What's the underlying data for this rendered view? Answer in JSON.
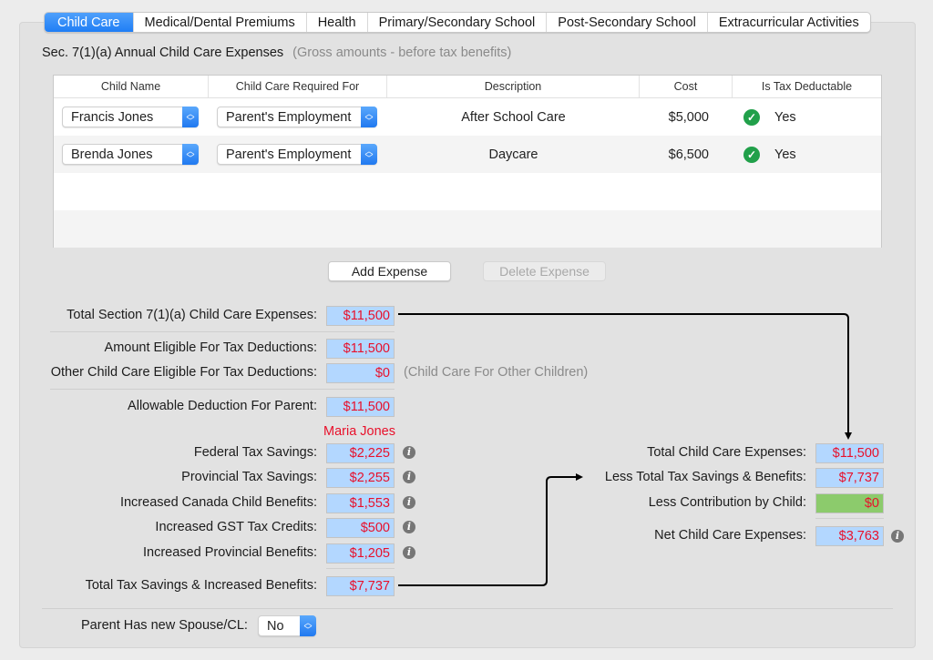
{
  "tabs": [
    {
      "label": "Child Care",
      "active": true
    },
    {
      "label": "Medical/Dental Premiums",
      "active": false
    },
    {
      "label": "Health",
      "active": false
    },
    {
      "label": "Primary/Secondary School",
      "active": false
    },
    {
      "label": "Post-Secondary School",
      "active": false
    },
    {
      "label": "Extracurricular Activities",
      "active": false
    }
  ],
  "section": {
    "title": "Sec. 7(1)(a)  Annual Child Care Expenses",
    "subtitle": "(Gross amounts - before tax benefits)"
  },
  "table": {
    "headers": [
      "Child Name",
      "Child Care Required For",
      "Description",
      "Cost",
      "Is Tax Deductable"
    ],
    "rows": [
      {
        "child": "Francis Jones",
        "required_for": "Parent's Employment",
        "description": "After School Care",
        "cost": "$5,000",
        "deductible": "Yes"
      },
      {
        "child": "Brenda Jones",
        "required_for": "Parent's Employment",
        "description": "Daycare",
        "cost": "$6,500",
        "deductible": "Yes"
      }
    ]
  },
  "buttons": {
    "add": "Add Expense",
    "delete": "Delete Expense"
  },
  "left": {
    "total_section": {
      "label": "Total Section 7(1)(a) Child Care Expenses:",
      "value": "$11,500"
    },
    "eligible": {
      "label": "Amount Eligible For Tax Deductions:",
      "value": "$11,500"
    },
    "other_eligible": {
      "label": "Other Child Care Eligible For Tax Deductions:",
      "value": "$0",
      "note": "(Child Care For Other Children)"
    },
    "allowable": {
      "label": "Allowable Deduction For Parent:",
      "value": "$11,500"
    },
    "parent_name": "Maria Jones",
    "savings": [
      {
        "label": "Federal Tax Savings:",
        "value": "$2,225"
      },
      {
        "label": "Provincial Tax Savings:",
        "value": "$2,255"
      },
      {
        "label": "Increased Canada Child Benefits:",
        "value": "$1,553"
      },
      {
        "label": "Increased GST Tax Credits:",
        "value": "$500"
      },
      {
        "label": "Increased Provincial Benefits:",
        "value": "$1,205"
      }
    ],
    "total_savings": {
      "label": "Total Tax Savings & Increased Benefits:",
      "value": "$7,737"
    }
  },
  "right": {
    "total_expenses": {
      "label": "Total Child Care Expenses:",
      "value": "$11,500"
    },
    "less_savings": {
      "label": "Less Total Tax Savings & Benefits:",
      "value": "$7,737"
    },
    "less_contribution": {
      "label": "Less Contribution by Child:",
      "value": "$0"
    },
    "net": {
      "label": "Net Child Care Expenses:",
      "value": "$3,763"
    }
  },
  "spouse": {
    "label": "Parent Has new Spouse/CL:",
    "value": "No"
  },
  "colors": {
    "accent": "#1f7ef5",
    "value_bg": "#b3d7ff",
    "value_text": "#e8102a",
    "input_green": "#8ccb6c",
    "check_green": "#21a04a"
  }
}
